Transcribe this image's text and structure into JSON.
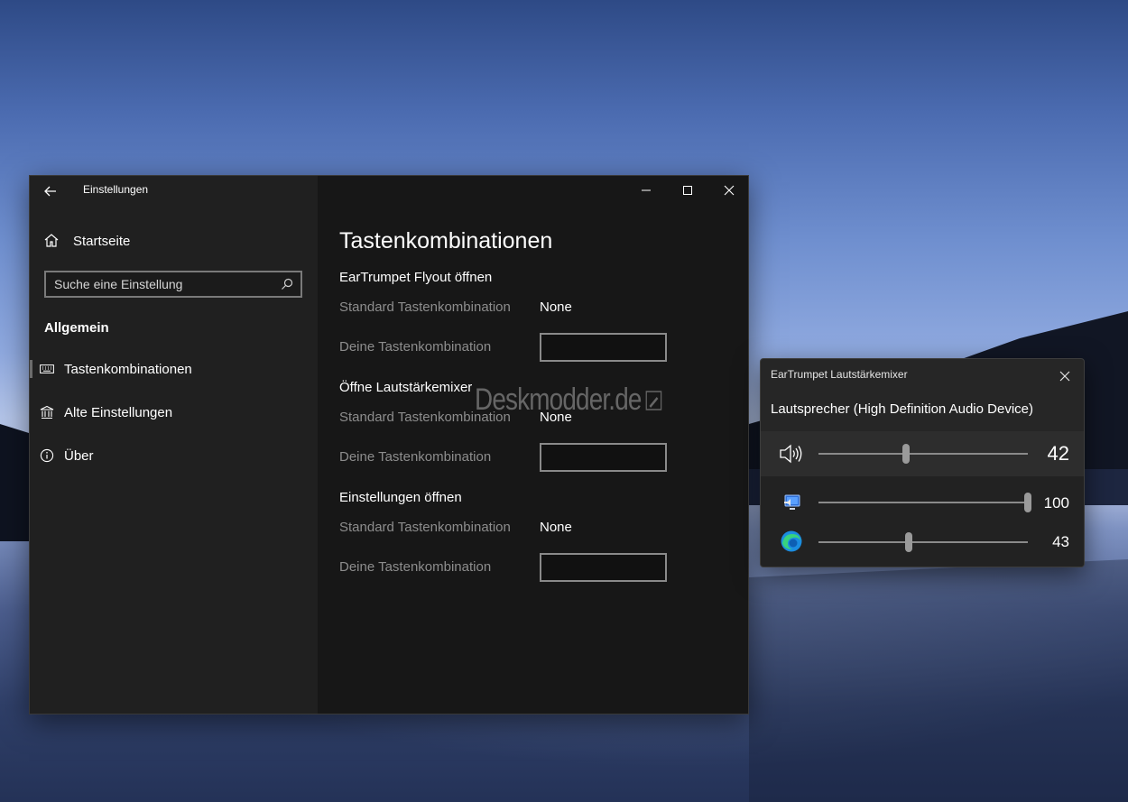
{
  "settings": {
    "window_title": "Einstellungen",
    "nav": {
      "home_label": "Startseite",
      "search_placeholder": "Suche eine Einstellung",
      "section_label": "Allgemein",
      "items": [
        {
          "label": "Tastenkombinationen",
          "icon": "keyboard-icon",
          "active": true
        },
        {
          "label": "Alte Einstellungen",
          "icon": "bank-icon",
          "active": false
        },
        {
          "label": "Über",
          "icon": "info-icon",
          "active": false
        }
      ]
    },
    "page_title": "Tastenkombinationen",
    "groups": [
      {
        "title": "EarTrumpet Flyout öffnen",
        "default_label": "Standard Tastenkombination",
        "default_value": "None",
        "custom_label": "Deine Tastenkombination",
        "custom_value": ""
      },
      {
        "title": "Öffne Lautstärkemixer",
        "default_label": "Standard Tastenkombination",
        "default_value": "None",
        "custom_label": "Deine Tastenkombination",
        "custom_value": ""
      },
      {
        "title": "Einstellungen öffnen",
        "default_label": "Standard Tastenkombination",
        "default_value": "None",
        "custom_label": "Deine Tastenkombination",
        "custom_value": ""
      }
    ]
  },
  "watermark": {
    "text": "Deskmodder.de"
  },
  "mixer": {
    "title": "EarTrumpet Lautstärkemixer",
    "device_name": "Lautsprecher (High Definition Audio Device)",
    "device_volume": 42,
    "apps": [
      {
        "icon": "system-sounds-icon",
        "volume": 100
      },
      {
        "icon": "edge-browser-icon",
        "volume": 43
      }
    ]
  },
  "colors": {
    "accent": "#8a8a8a",
    "window_bg": "#1f1f1f",
    "content_bg": "#171717",
    "text": "#ffffff",
    "muted_text": "#8d8d8d"
  }
}
